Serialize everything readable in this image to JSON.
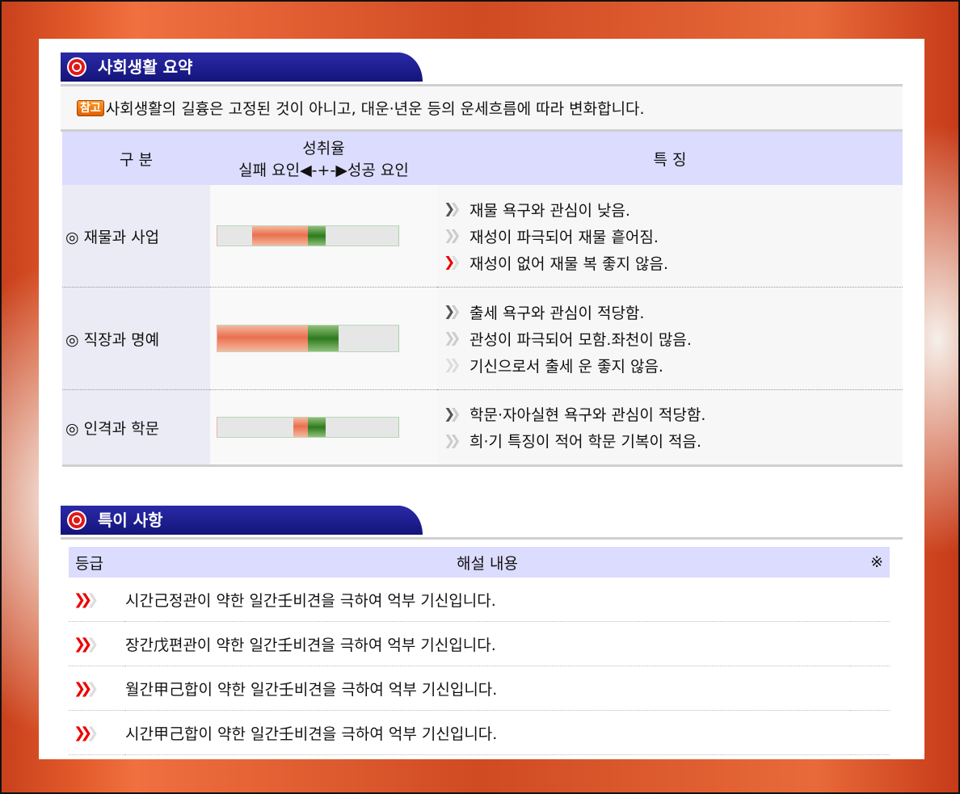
{
  "sections": {
    "summary_title": "사회생활 요약",
    "special_title": "특이 사항"
  },
  "note": {
    "badge": "참고",
    "text": "사회생활의 길흉은 고정된 것이 아니고, 대운·년운 등의 운세흐름에 따라 변화합니다."
  },
  "summary_table": {
    "col_category": "구 분",
    "col_rate_line1": "성취율",
    "col_rate_line2": "실패 요인◀-+-▶성공 요인",
    "col_features": "특 징",
    "rows": [
      {
        "category": "◎ 재물과 사업",
        "bar": {
          "red_start": 0.19,
          "red_end": 0.5,
          "green_end": 0.6
        },
        "features": [
          {
            "level": "gray",
            "text": "재물 욕구와 관심이 낮음."
          },
          {
            "level": "light",
            "text": "재성이 파극되어 재물 흩어짐."
          },
          {
            "level": "red1",
            "text": "재성이 없어 재물 복 좋지 않음."
          }
        ]
      },
      {
        "category": "◎ 직장과 명예",
        "bar": {
          "red_start": 0.0,
          "red_end": 0.5,
          "green_end": 0.67
        },
        "features": [
          {
            "level": "gray",
            "text": "출세 욕구와 관심이 적당함."
          },
          {
            "level": "light",
            "text": "관성이 파극되어 모함.좌천이 많음."
          },
          {
            "level": "red2",
            "text": "기신으로서 출세 운 좋지 않음."
          }
        ]
      },
      {
        "category": "◎ 인격과 학문",
        "bar": {
          "red_start": 0.42,
          "red_end": 0.5,
          "green_end": 0.6
        },
        "features": [
          {
            "level": "gray",
            "text": "학문·자아실현 욕구와 관심이 적당함."
          },
          {
            "level": "light",
            "text": "희·기 특징이 적어 학문 기복이 적음."
          }
        ]
      }
    ]
  },
  "special_table": {
    "col_grade": "등급",
    "col_desc": "해설 내용",
    "col_mark": "※",
    "rows": [
      {
        "text": "시간己정관이 약한 일간壬비견을 극하여 억부 기신입니다."
      },
      {
        "text": "장간戊편관이 약한 일간壬비견을 극하여 억부 기신입니다."
      },
      {
        "text": "월간甲己합이 약한 일간壬비견을 극하여 억부 기신입니다."
      },
      {
        "text": "시간甲己합이 약한 일간壬비견을 극하여 억부 기신입니다."
      }
    ]
  },
  "colors": {
    "header_blue": "#14147a",
    "table_header": "#dcdcff",
    "bar_red": "#e8704e",
    "bar_green": "#2e7a1e",
    "accent_red": "#e00000"
  }
}
